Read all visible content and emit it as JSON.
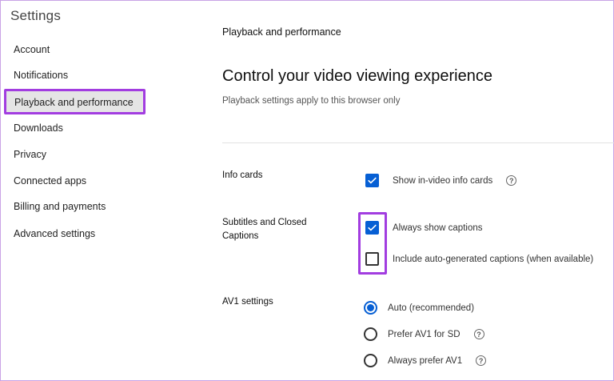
{
  "sidebar": {
    "title": "Settings",
    "items": [
      {
        "label": "Account"
      },
      {
        "label": "Notifications"
      },
      {
        "label": "Playback and performance"
      },
      {
        "label": "Downloads"
      },
      {
        "label": "Privacy"
      },
      {
        "label": "Connected apps"
      },
      {
        "label": "Billing and payments"
      },
      {
        "label": "Advanced settings"
      }
    ],
    "active_index": 2
  },
  "main": {
    "section_heading": "Playback and performance",
    "title": "Control your video viewing experience",
    "subtitle": "Playback settings apply to this browser only",
    "info_cards": {
      "label": "Info cards",
      "option": {
        "label": "Show in-video info cards",
        "checked": true,
        "help_icon": "?"
      }
    },
    "subtitles": {
      "label_line1": "Subtitles and Closed",
      "label_line2": "Captions",
      "options": [
        {
          "label": "Always show captions",
          "checked": true
        },
        {
          "label": "Include auto-generated captions (when available)",
          "checked": false
        }
      ]
    },
    "av1": {
      "label": "AV1 settings",
      "options": [
        {
          "label": "Auto (recommended)",
          "selected": true
        },
        {
          "label": "Prefer AV1 for SD",
          "selected": false,
          "help_icon": "?"
        },
        {
          "label": "Always prefer AV1",
          "selected": false,
          "help_icon": "?"
        }
      ]
    }
  },
  "colors": {
    "accent_blue": "#065fd4",
    "highlight_purple": "#a23de0",
    "active_bg": "#e5e5e5"
  }
}
